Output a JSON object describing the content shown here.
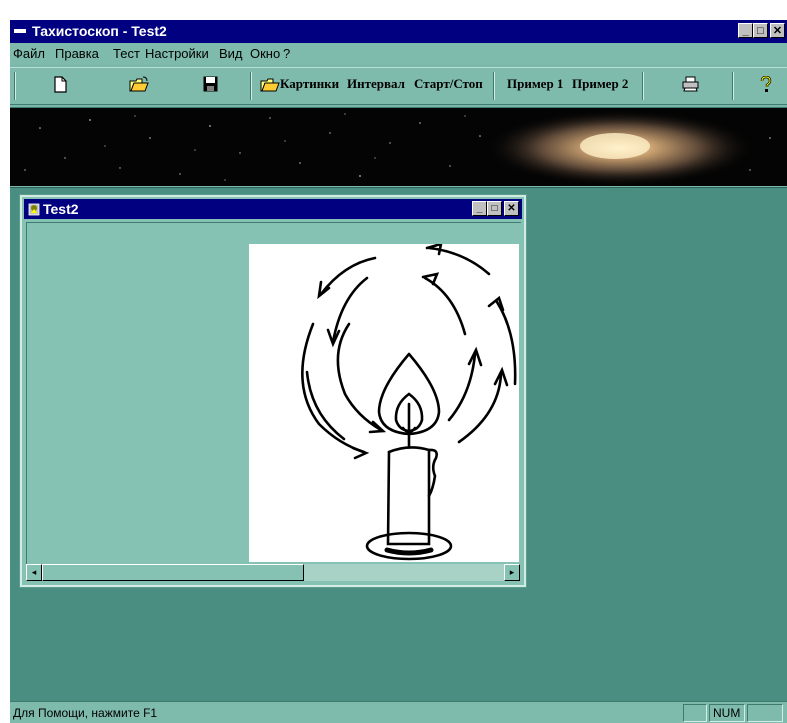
{
  "app": {
    "title": "Тахистоскоп - Test2",
    "window_controls": {
      "minimize": "_",
      "maximize": "□",
      "close": "✕"
    }
  },
  "menu": [
    "Файл",
    "Правка",
    "Тест",
    "Настройки",
    "Вид",
    "Окно",
    "?"
  ],
  "toolbar": {
    "icons": [
      "new-file-icon",
      "open-folder-icon",
      "save-disk-icon",
      "print-icon",
      "help-icon"
    ],
    "pictures_label": "Картинки",
    "interval_label": "Интервал",
    "startstop_label": "Старт/Стоп",
    "example1_label": "Пример 1",
    "example2_label": "Пример 2"
  },
  "child_window": {
    "title": "Test2",
    "controls": {
      "minimize": "_",
      "maximize": "□",
      "close": "✕"
    },
    "scroll_left": "◂",
    "scroll_right": "▸"
  },
  "statusbar": {
    "help_text": "Для Помощи, нажмите F1",
    "num_indicator": "NUM"
  },
  "colors": {
    "titlebar": "#000080",
    "workspace": "#4a8e82",
    "chrome": "#7fbbac"
  }
}
